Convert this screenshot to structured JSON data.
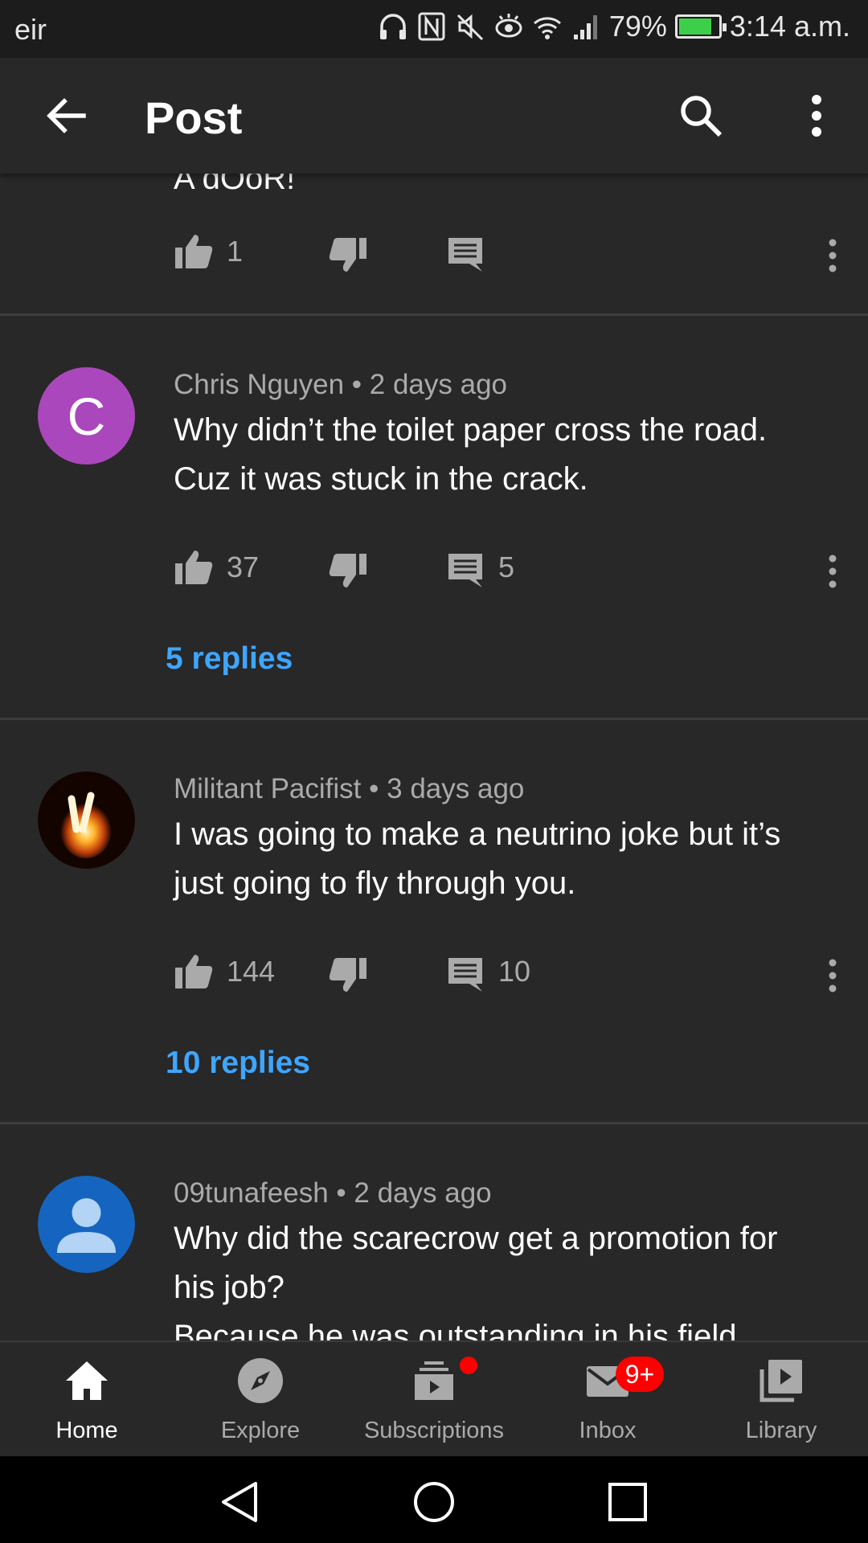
{
  "status_bar": {
    "carrier": "eir",
    "battery_percent": "79%",
    "time": "3:14 a.m."
  },
  "app_bar": {
    "title": "Post"
  },
  "top_comment": {
    "text": "A dOoR!",
    "likes": "1"
  },
  "comments": [
    {
      "author": "Chris Nguyen",
      "time": "2 days ago",
      "avatar_letter": "C",
      "avatar_color": "#ab47bc",
      "lines": [
        "Why didn’t the toilet paper cross the road.",
        "Cuz it was stuck in the crack."
      ],
      "likes": "37",
      "reply_count": "5",
      "replies_link": "5 replies"
    },
    {
      "author": "Militant Pacifist",
      "time": "3 days ago",
      "lines": [
        "I was going to make a neutrino joke but it’s",
        "just going to fly through you."
      ],
      "likes": "144",
      "reply_count": "10",
      "replies_link": "10 replies"
    },
    {
      "author": "09tunafeesh",
      "time": "2 days ago",
      "avatar_color": "#1565c0",
      "lines": [
        "Why did the scarecrow get a promotion for",
        "his job?",
        "Because he was outstanding in his field."
      ]
    }
  ],
  "meta_separator": "•",
  "bottom_nav": {
    "items": [
      {
        "label": "Home",
        "icon": "home-icon",
        "active": true
      },
      {
        "label": "Explore",
        "icon": "compass-icon"
      },
      {
        "label": "Subscriptions",
        "icon": "subscriptions-icon",
        "has_dot": true
      },
      {
        "label": "Inbox",
        "icon": "mail-icon",
        "badge": "9+"
      },
      {
        "label": "Library",
        "icon": "library-icon"
      }
    ]
  },
  "colors": {
    "background": "#282828",
    "accent_link": "#3ea6ff",
    "badge": "#ff0000"
  }
}
